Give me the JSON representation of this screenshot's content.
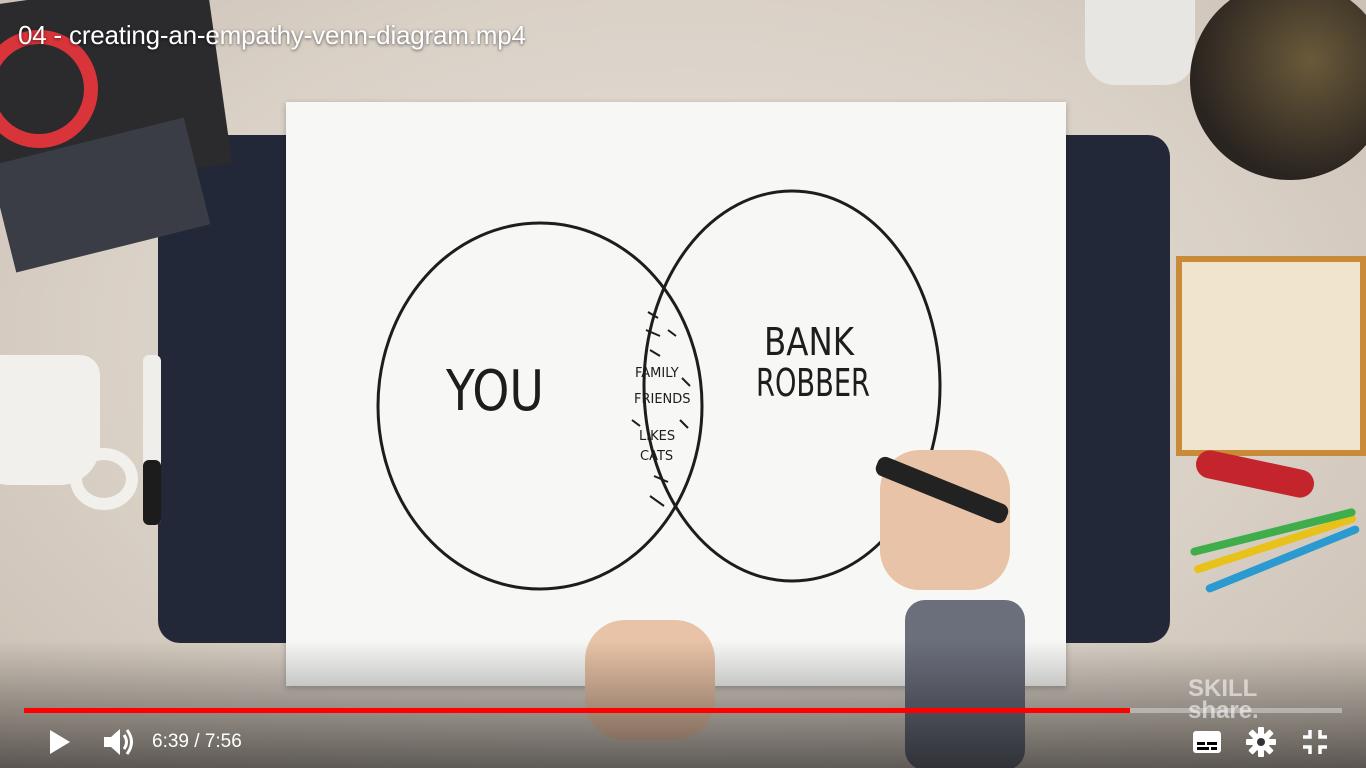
{
  "video": {
    "title": "04 - creating-an-empathy-venn-diagram.mp4",
    "current_time": "6:39",
    "duration": "7:56",
    "time_display": "6:39 / 7:56",
    "progress_fraction": 0.839,
    "watermark_line1": "SKILL",
    "watermark_line2": "share."
  },
  "venn": {
    "left_label": "YOU",
    "right_label_line1": "BANK",
    "right_label_line2": "ROBBER",
    "overlap_items": [
      "FAMILY",
      "FRIENDS",
      "LIKES",
      "CATS"
    ]
  },
  "controls": {
    "play_icon": "play-icon",
    "volume_icon": "volume-icon",
    "subtitles_icon": "subtitles-icon",
    "settings_icon": "gear-icon",
    "exit_fullscreen_icon": "exit-fullscreen-icon"
  },
  "colors": {
    "progress": "#ff0000",
    "ink": "#1d1d1d"
  }
}
